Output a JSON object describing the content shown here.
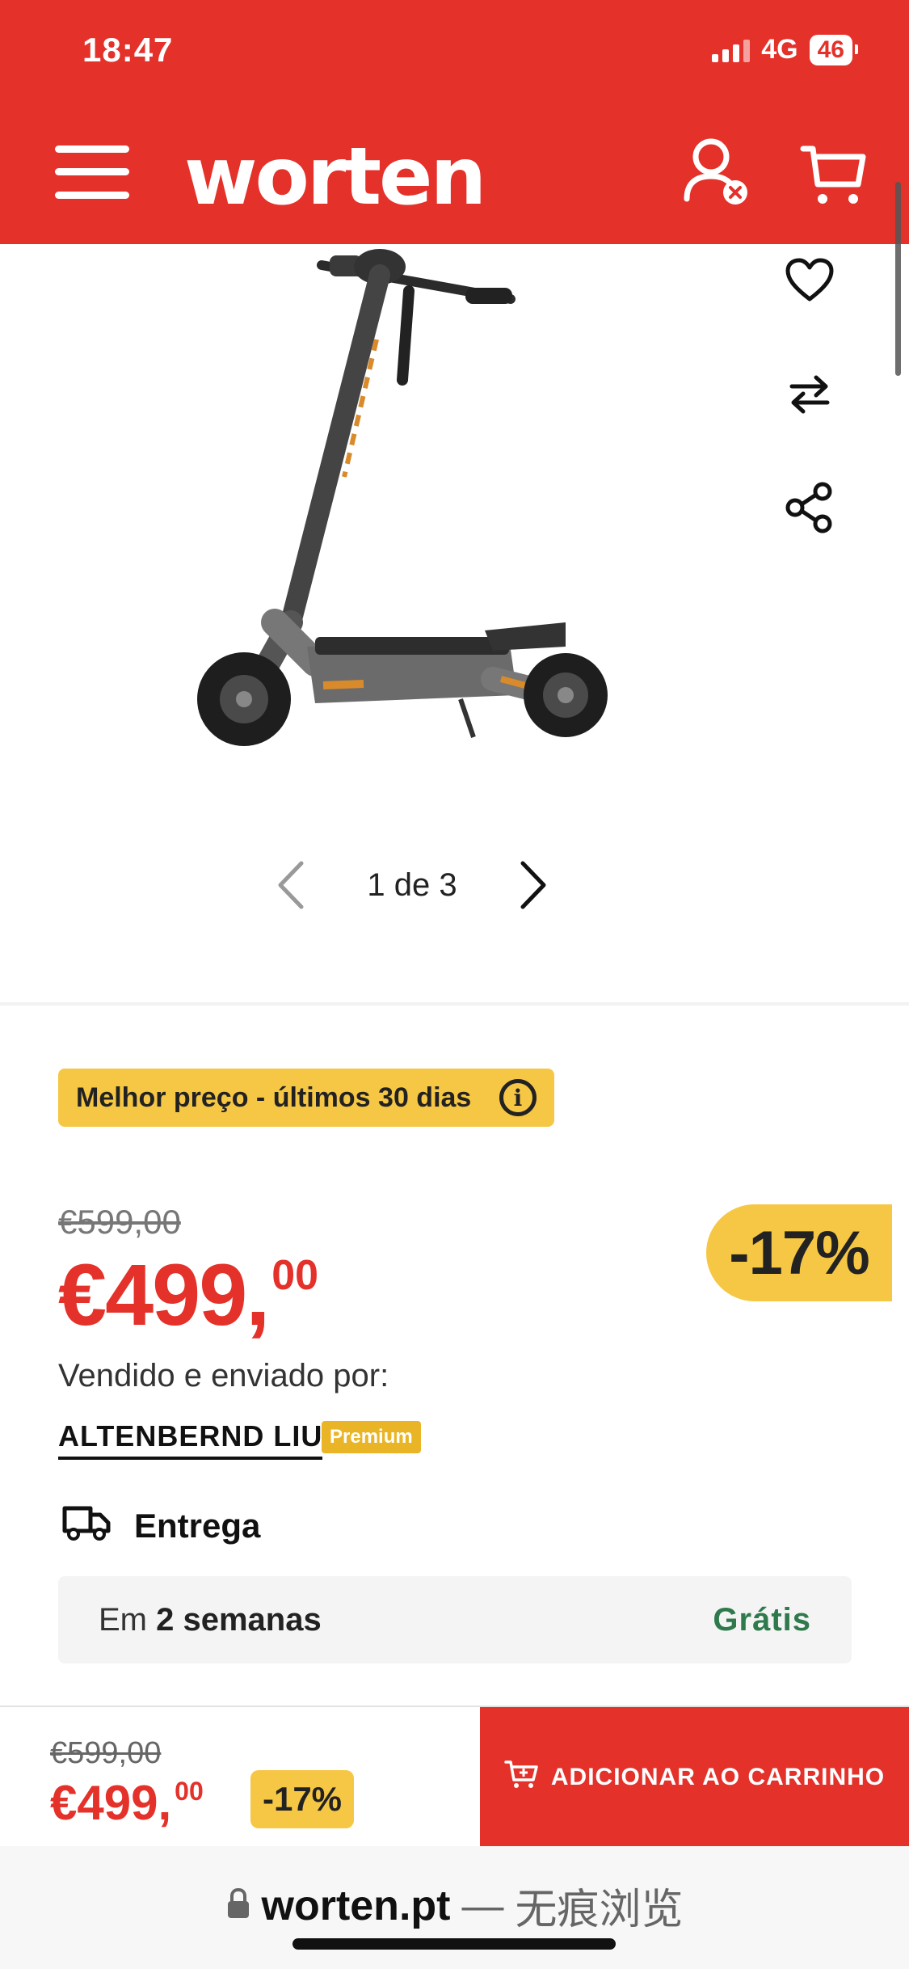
{
  "status_bar": {
    "time": "18:47",
    "network": "4G",
    "battery": "46"
  },
  "header": {
    "logo": "worten",
    "menu_icon": "hamburger-menu-icon",
    "user_icon": "user-account-icon",
    "cart_icon": "shopping-cart-icon",
    "brand_color": "#e4312a"
  },
  "gallery": {
    "counter": "1 de 3",
    "prev_icon": "chevron-left-icon",
    "next_icon": "chevron-right-icon",
    "product_image": "electric-scooter"
  },
  "side_actions": [
    "heart-icon",
    "compare-arrows-icon",
    "share-icon"
  ],
  "product": {
    "best_price_label": "Melhor preço - últimos 30 dias",
    "old_price": "€599,00",
    "price_main": "€499,",
    "price_cents": "00",
    "discount": "-17%",
    "sold_by_label": "Vendido e enviado por:",
    "seller": "ALTENBERND LIU",
    "seller_badge": "Premium"
  },
  "delivery": {
    "title": "Entrega",
    "when_prefix": "Em ",
    "when_value": "2 semanas",
    "cost": "Grátis",
    "cost_color": "#2f7a4c"
  },
  "sticky_bar": {
    "old_price": "€599,00",
    "price_main": "€499,",
    "price_cents": "00",
    "discount": "-17%",
    "add_to_cart": "ADICIONAR AO CARRINHO"
  },
  "browser": {
    "host": "worten.pt",
    "separator": "—",
    "mode": "无痕浏览"
  }
}
